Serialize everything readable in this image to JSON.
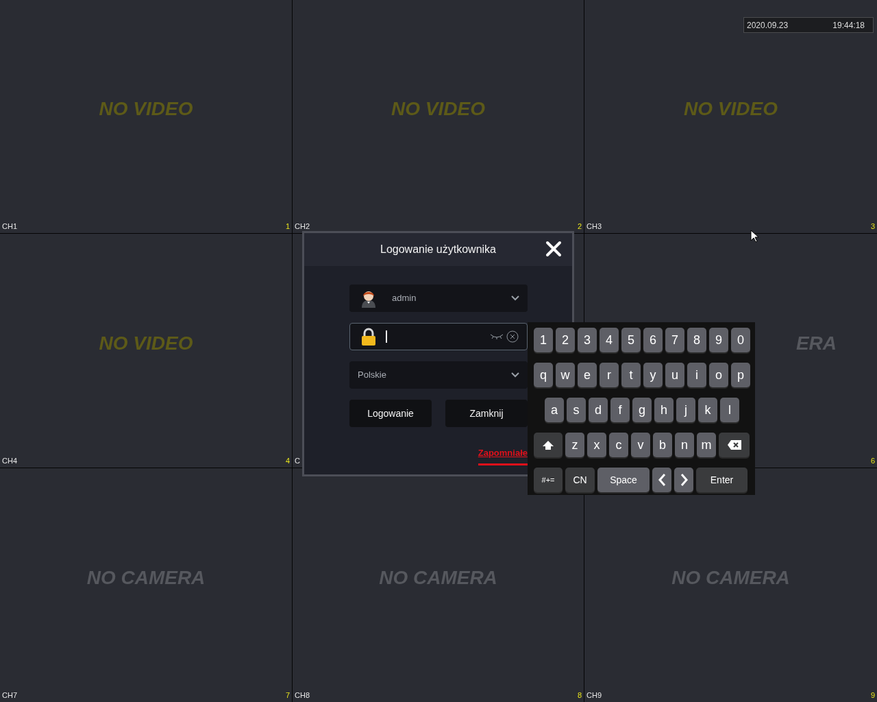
{
  "tiles": [
    {
      "label": "CH1",
      "number": "1",
      "status": "NO VIDEO",
      "kind": "no_video"
    },
    {
      "label": "CH2",
      "number": "2",
      "status": "NO VIDEO",
      "kind": "no_video"
    },
    {
      "label": "CH3",
      "number": "3",
      "status": "NO VIDEO",
      "kind": "no_video"
    },
    {
      "label": "CH4",
      "number": "4",
      "status": "NO VIDEO",
      "kind": "no_video"
    },
    {
      "label": "C"
    },
    {
      "number": "6",
      "status": "ERA",
      "kind": "no_camera"
    },
    {
      "label": "CH7",
      "number": "7",
      "status": "NO CAMERA",
      "kind": "no_camera"
    },
    {
      "label": "CH8",
      "number": "8",
      "status": "NO CAMERA",
      "kind": "no_camera"
    },
    {
      "label": "CH9",
      "number": "9",
      "status": "NO CAMERA",
      "kind": "no_camera"
    }
  ],
  "clock": {
    "date": "2020.09.23",
    "time": "19:44:18"
  },
  "dialog": {
    "title": "Logowanie użytkownika",
    "user": "admin",
    "language": "Polskie",
    "buttons": [
      "Logowanie",
      "Zamknij"
    ],
    "forgot_link": "Zapomniałe"
  },
  "keyboard": {
    "digit_keys": [
      {
        "kind": "char",
        "label": "1"
      },
      {
        "kind": "char",
        "label": "2"
      },
      {
        "kind": "char",
        "label": "3"
      },
      {
        "kind": "char",
        "label": "4"
      },
      {
        "kind": "char",
        "label": "5"
      },
      {
        "kind": "char",
        "label": "6"
      },
      {
        "kind": "char",
        "label": "7"
      },
      {
        "kind": "char",
        "label": "8"
      },
      {
        "kind": "char",
        "label": "9"
      },
      {
        "kind": "char",
        "label": "0"
      }
    ],
    "top_letter_keys": [
      {
        "kind": "char",
        "label": "q"
      },
      {
        "kind": "char",
        "label": "w"
      },
      {
        "kind": "char",
        "label": "e"
      },
      {
        "kind": "char",
        "label": "r"
      },
      {
        "kind": "char",
        "label": "t"
      },
      {
        "kind": "char",
        "label": "y"
      },
      {
        "kind": "char",
        "label": "u"
      },
      {
        "kind": "char",
        "label": "i"
      },
      {
        "kind": "char",
        "label": "o"
      },
      {
        "kind": "char",
        "label": "p"
      }
    ],
    "middle_letter_keys": [
      {
        "kind": "char",
        "label": "a"
      },
      {
        "kind": "char",
        "label": "s"
      },
      {
        "kind": "char",
        "label": "d"
      },
      {
        "kind": "char",
        "label": "f"
      },
      {
        "kind": "char",
        "label": "g"
      },
      {
        "kind": "char",
        "label": "h"
      },
      {
        "kind": "char",
        "label": "j"
      },
      {
        "kind": "char",
        "label": "k"
      },
      {
        "kind": "char",
        "label": "l"
      }
    ],
    "bottom_letter_keys": [
      {
        "kind": "shift"
      },
      {
        "kind": "char",
        "label": "z"
      },
      {
        "kind": "char",
        "label": "x"
      },
      {
        "kind": "char",
        "label": "c"
      },
      {
        "kind": "char",
        "label": "v"
      },
      {
        "kind": "char",
        "label": "b"
      },
      {
        "kind": "char",
        "label": "n"
      },
      {
        "kind": "char",
        "label": "m"
      },
      {
        "kind": "backspace"
      }
    ],
    "function_keys": [
      {
        "kind": "symbols",
        "label": "#+="
      },
      {
        "kind": "lang",
        "label": "CN"
      },
      {
        "kind": "space",
        "label": "Space"
      },
      {
        "kind": "left"
      },
      {
        "kind": "right"
      },
      {
        "kind": "enter",
        "label": "Enter"
      }
    ]
  }
}
